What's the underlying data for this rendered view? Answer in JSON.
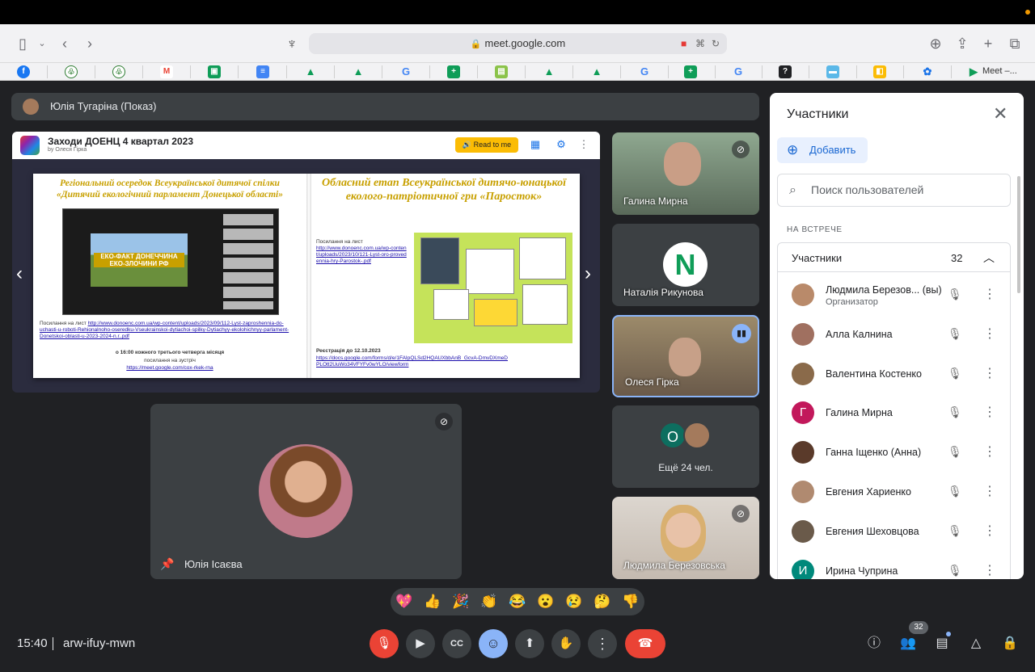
{
  "browser": {
    "url": "meet.google.com",
    "last_bookmark": "Meet –..."
  },
  "presenter_bar": {
    "text": "Юлія Тугаріна (Показ)"
  },
  "slide": {
    "title": "Заходи ДОЕНЦ 4 квартал 2023",
    "author": "by Олеся Гірка",
    "read_button": "Read to me",
    "left": {
      "title": "Регіональний осередок Всеукраїнської дитячої спілки «Дитячий екологічний парламент Донецької області»",
      "banner": "ЕКО-ФАКТ ДОНЕЧЧИНА ЕКО-ЗЛОЧИНИ РФ",
      "link_label": "Посилання на лист",
      "link_url": "http://www.donoenc.com.ua/wp-content/uploads/2023/09/112-Lyst-zaproshennia-do-uchasti-u-roboti-Rehionalnoho-oseredku-Vseukrainskoi-dytiachoi-spilky-Dytiachyy-ekolohichnyy-parlament-Donetskoi-oblasti-u-2023-2024-n.r..pdf",
      "schedule": "о 16:00 кожного третього четверга місяця",
      "meet_label": "посилання на зустріч",
      "meet_url": "https://meet.google.com/cox-rkek-rna"
    },
    "right": {
      "title": "Обласний етап Всеукраїнської дитячо-юнацької еколого-патріотичної гри «Паросток»",
      "link_label": "Посилання на лист",
      "link_url": "http://www.donoenc.com.ua/wp-content/uploads/2023/10/121-Lyst-oro-provedennia-hry-Parostok-.pdf",
      "reg_label": "Реєстрація до 12.10.2023",
      "reg_url": "https://docs.google.com/forms/d/e/1FAIpQLSd2HQAUXbbAnB_GcvA-DmvDXmeDPLOtt2UuWo34VFYFv0wYLO/viewform"
    }
  },
  "tiles": [
    {
      "name": "Галина Мирна"
    },
    {
      "name": "Наталія Рикунова",
      "initial": "N"
    },
    {
      "name": "Олеся Гірка"
    },
    {
      "initial": "О",
      "more": "Ещё 24 чел."
    },
    {
      "name": "Людмила Березовська"
    }
  ],
  "main_tile": {
    "name": "Юлія Ісаєва"
  },
  "panel": {
    "title": "Участники",
    "add_label": "Добавить",
    "search_placeholder": "Поиск пользователей",
    "section": "НА ВСТРЕЧЕ",
    "group_label": "Участники",
    "group_count": "32",
    "participants": [
      {
        "name": "Людмила Березов... (вы)",
        "role": "Организатор",
        "avatar_color": "#b98a6a"
      },
      {
        "name": "Алла Калнина",
        "avatar_color": "#a07060"
      },
      {
        "name": "Валентина Костенко",
        "avatar_color": "#8a6a4a"
      },
      {
        "name": "Галина Мирна",
        "initial": "Г",
        "avatar_color": "#c2185b"
      },
      {
        "name": "Ганна Іщенко (Анна)",
        "avatar_color": "#5a3a2a"
      },
      {
        "name": "Евгения Хариенко",
        "avatar_color": "#b08a70"
      },
      {
        "name": "Евгения Шеховцова",
        "avatar_color": "#6a5a4a"
      },
      {
        "name": "Ирина Чуприна",
        "initial": "И",
        "avatar_color": "#00897b"
      }
    ]
  },
  "footer": {
    "time": "15:40",
    "meeting_code": "arw-ifuy-mwn",
    "people_count": "32"
  },
  "colors": {
    "meet_bg": "#202124",
    "tile_bg": "#3c4043",
    "hangup": "#ea4335",
    "accent": "#8ab4f8"
  }
}
